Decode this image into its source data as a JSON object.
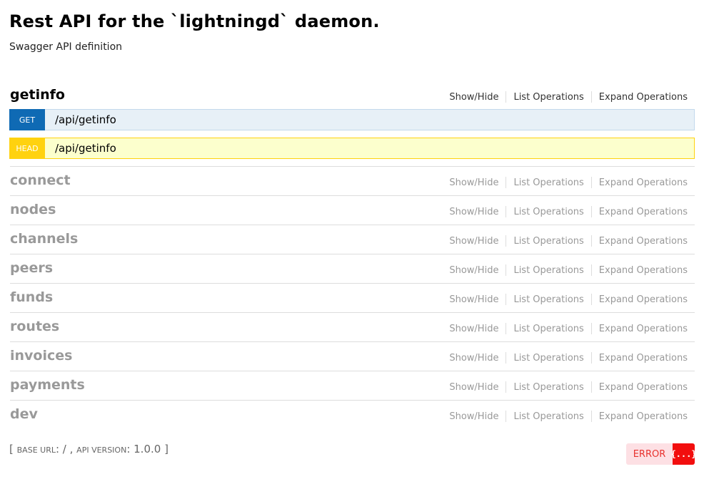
{
  "header": {
    "title": "Rest API for the `lightningd` daemon.",
    "subtitle": "Swagger API definition"
  },
  "resource_ops": {
    "show_hide": "Show/Hide",
    "list_operations": "List Operations",
    "expand_operations": "Expand Operations"
  },
  "resources": [
    {
      "name": "getinfo"
    },
    {
      "name": "connect"
    },
    {
      "name": "nodes"
    },
    {
      "name": "channels"
    },
    {
      "name": "peers"
    },
    {
      "name": "funds"
    },
    {
      "name": "routes"
    },
    {
      "name": "invoices"
    },
    {
      "name": "payments"
    },
    {
      "name": "dev"
    }
  ],
  "endpoints": [
    {
      "method": "GET",
      "path": "/api/getinfo"
    },
    {
      "method": "HEAD",
      "path": "/api/getinfo"
    }
  ],
  "footer": {
    "open_bracket": "[",
    "base_url_label": "base url",
    "base_url_value": "/",
    "api_version_label": "api version",
    "api_version_value": "1.0.0",
    "close_bracket": "]"
  },
  "validator": {
    "status": "ERROR",
    "icon_text": "{...}"
  },
  "colors": {
    "get": "#0f6ab4",
    "head": "#ffd20f",
    "error": "#f20e0e"
  }
}
